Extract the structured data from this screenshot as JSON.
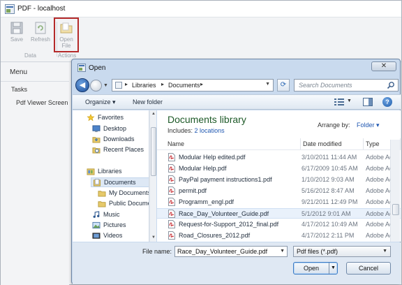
{
  "app": {
    "title": "PDF - localhost",
    "ribbon": {
      "save_label": "Save",
      "refresh_label": "Refresh",
      "open_file_label_1": "Open",
      "open_file_label_2": "File",
      "group_data": "Data",
      "group_actions": "Actions"
    },
    "left_pane": {
      "menu_label": "Menu",
      "tasks_label": "Tasks",
      "items": [
        "Pdf Viewer Screen"
      ]
    }
  },
  "dialog": {
    "title": "Open",
    "close_label": "✕",
    "address": {
      "segments": [
        "Libraries",
        "Documents"
      ]
    },
    "search": {
      "placeholder": "Search Documents"
    },
    "toolbar": {
      "organize": "Organize ▾",
      "new_folder": "New folder"
    },
    "nav": {
      "favorites": "Favorites",
      "favorite_items": [
        "Desktop",
        "Downloads",
        "Recent Places"
      ],
      "libraries": "Libraries",
      "library_items": [
        "Documents",
        "My Documents",
        "Public Docume",
        "Music",
        "Pictures",
        "Videos"
      ]
    },
    "library": {
      "title": "Documents library",
      "includes_label": "Includes:",
      "locations": "2 locations",
      "arrange_by_label": "Arrange by:",
      "arrange_by_value": "Folder ▾"
    },
    "columns": {
      "name": "Name",
      "date_modified": "Date modified",
      "type": "Type"
    },
    "files": [
      {
        "name": "Modular Help edited.pdf",
        "date": "3/10/2011 11:44 AM",
        "type": "Adobe Ac"
      },
      {
        "name": "Modular Help.pdf",
        "date": "6/17/2009 10:45 AM",
        "type": "Adobe Ac"
      },
      {
        "name": "PayPal payment instructions1.pdf",
        "date": "1/10/2012 9:03 AM",
        "type": "Adobe Ac"
      },
      {
        "name": "permit.pdf",
        "date": "5/16/2012 8:47 AM",
        "type": "Adobe Ac"
      },
      {
        "name": "Programm_engl.pdf",
        "date": "9/21/2011 12:49 PM",
        "type": "Adobe Ac"
      },
      {
        "name": "Race_Day_Volunteer_Guide.pdf",
        "date": "5/1/2012 9:01 AM",
        "type": "Adobe Ac"
      },
      {
        "name": "Request-for-Support_2012_final.pdf",
        "date": "4/17/2012 10:49 AM",
        "type": "Adobe Ac"
      },
      {
        "name": "Road_Closures_2012.pdf",
        "date": "4/17/2012 2:11 PM",
        "type": "Adobe Ac"
      }
    ],
    "bottom": {
      "file_name_label": "File name:",
      "file_name_value": "Race_Day_Volunteer_Guide.pdf",
      "filter_value": "Pdf files (*.pdf)",
      "open_label": "Open",
      "cancel_label": "Cancel"
    }
  },
  "colors": {
    "accent": "#1f57b1",
    "library_title": "#1e5a28",
    "highlight_border": "#b52a2a",
    "pdf_icon": "#c4232a"
  }
}
